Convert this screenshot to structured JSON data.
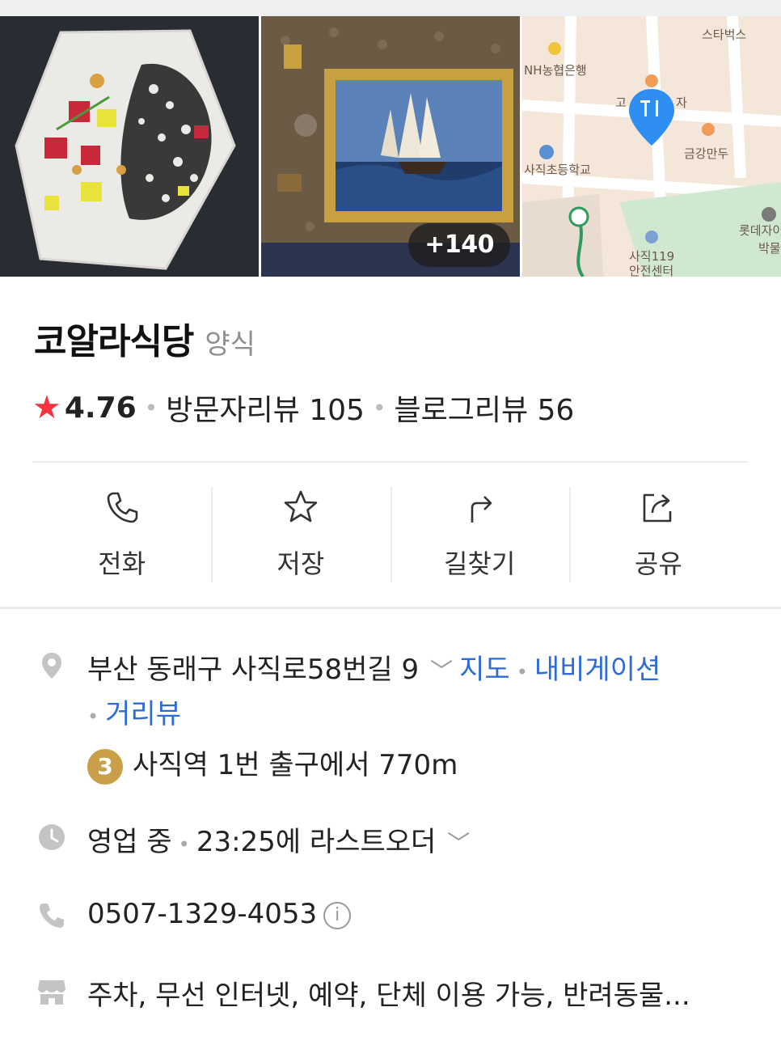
{
  "photos": {
    "more_count": "+140",
    "map_labels": [
      "스타벅스",
      "NH농협은행",
      "고",
      "자",
      "금강만두",
      "사직초등학교",
      "롯데자이",
      "박물",
      "사직119",
      "안전센터"
    ]
  },
  "place": {
    "name": "코알라식당",
    "category": "양식"
  },
  "rating": {
    "star": "★",
    "score": "4.76",
    "visitor_reviews": "방문자리뷰 105",
    "blog_reviews": "블로그리뷰 56"
  },
  "actions": [
    {
      "label": "전화",
      "icon": "phone-icon"
    },
    {
      "label": "저장",
      "icon": "star-icon"
    },
    {
      "label": "길찾기",
      "icon": "directions-icon"
    },
    {
      "label": "공유",
      "icon": "share-icon"
    }
  ],
  "info": {
    "address": "부산 동래구 사직로58번길 9",
    "map_link": "지도",
    "navigation_link": "내비게이션",
    "street_view_link": "거리뷰",
    "subway_line": "3",
    "subway_text": "사직역 1번 출구에서 770m",
    "status": "영업 중",
    "last_order": "23:25에 라스트오더",
    "phone": "0507-1329-4053",
    "info_mark": "i",
    "amenities": "주차, 무선 인터넷, 예약, 단체 이용 가능, 반려동물..."
  },
  "colors": {
    "star": "#f5333f",
    "link": "#2f6bd4",
    "subway_line3": "#c9a049"
  }
}
